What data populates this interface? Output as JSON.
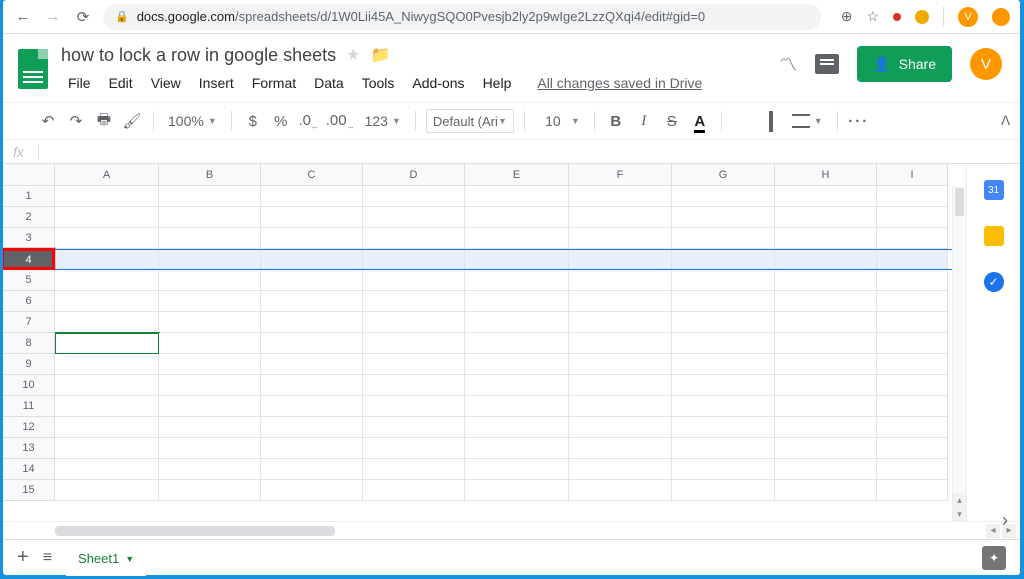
{
  "browser": {
    "host": "docs.google.com",
    "path": "/spreadsheets/d/1W0Lii45A_NiwygSQO0Pvesjb2ly2p9wIge2LzzQXqi4/edit#gid=0",
    "avatar_letter": "V"
  },
  "header": {
    "title": "how to lock a row in google sheets",
    "drive_status": "All changes saved in Drive",
    "share_label": "Share",
    "avatar_letter": "V"
  },
  "menus": {
    "file": "File",
    "edit": "Edit",
    "view": "View",
    "insert": "Insert",
    "format": "Format",
    "data": "Data",
    "tools": "Tools",
    "addons": "Add-ons",
    "help": "Help"
  },
  "toolbar": {
    "zoom": "100%",
    "currency": "$",
    "percent": "%",
    "dec_dec": ".0",
    "dec_inc": ".00",
    "more_fmt": "123",
    "font_name": "Default (Ari...",
    "font_size": "10",
    "bold": "B",
    "italic": "I",
    "strike": "S",
    "text_color": "A",
    "more": "···"
  },
  "formula_bar": {
    "fx": "fx"
  },
  "grid": {
    "columns": [
      "A",
      "B",
      "C",
      "D",
      "E",
      "F",
      "G",
      "H",
      "I"
    ],
    "rows": [
      "1",
      "2",
      "3",
      "4",
      "5",
      "6",
      "7",
      "8",
      "9",
      "10",
      "11",
      "12",
      "13",
      "14",
      "15"
    ],
    "selected_row": 4,
    "active_cell": "A8"
  },
  "tabs": {
    "sheet1": "Sheet1"
  },
  "sidebar": {
    "calendar_day": "31",
    "tasks_check": "✓"
  }
}
